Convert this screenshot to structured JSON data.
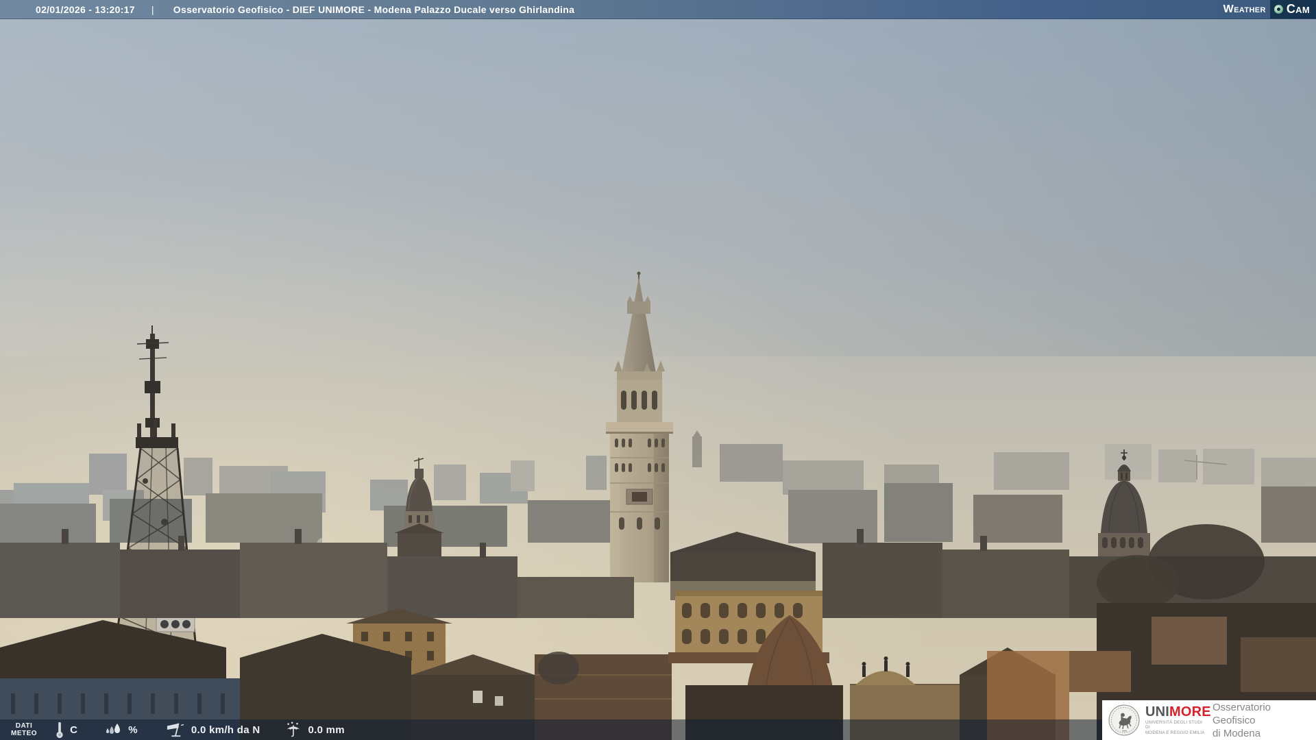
{
  "top_bar": {
    "timestamp": "02/01/2026 - 13:20:17",
    "separator": "|",
    "title": "Osservatorio Geofisico - DIEF UNIMORE - Modena Palazzo Ducale verso Ghirlandina",
    "weathercam": {
      "weather": "Weather",
      "cam": "Cam",
      "lens_icon": "camera-lens-icon"
    }
  },
  "bottom_bar": {
    "label_line1": "DATI",
    "label_line2": "METEO",
    "readings": {
      "temperature": {
        "icon": "thermometer-icon",
        "text": "C"
      },
      "humidity": {
        "icon": "water-drops-icon",
        "text": "%"
      },
      "wind": {
        "icon": "windsock-icon",
        "text": "0.0 km/h da N"
      },
      "rain": {
        "icon": "umbrella-icon",
        "text": "0.0 mm"
      }
    }
  },
  "footer_logo": {
    "seal_icon": "unimore-seal-icon",
    "brand_uni": "UNI",
    "brand_more": "MORE",
    "subtitle_line1": "UNIVERSITÀ DEGLI STUDI DI",
    "subtitle_line2": "MODENA E REGGIO EMILIA",
    "org_line1": "Osservatorio Geofisico",
    "org_line2": "di Modena"
  },
  "colors": {
    "topbar_left": "#7089a0",
    "topbar_right": "#3c5a7d",
    "weathercam_navy": "#16334f",
    "weathercam_lens": "#8fc7a8",
    "bottombar_overlay": "rgba(13,29,50,0.52)",
    "unimore_red": "#d5232b",
    "unimore_gray": "#55565a",
    "sky_top": "#a3b1bf",
    "sky_horizon": "#d6cbb2"
  }
}
